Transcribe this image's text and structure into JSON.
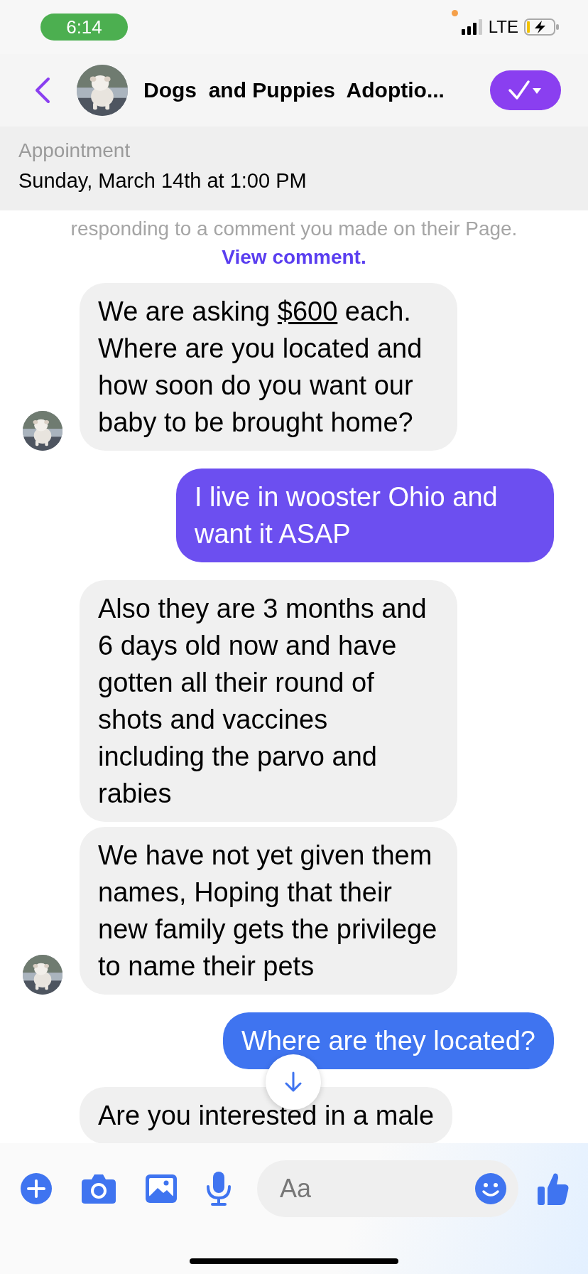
{
  "status_bar": {
    "time": "6:14",
    "network": "LTE"
  },
  "header": {
    "title": "Dogs  and Puppies  Adoptio..."
  },
  "appointment": {
    "label": "Appointment",
    "value": "Sunday, March 14th at 1:00 PM"
  },
  "notice": {
    "text": "responding to a comment you made on their Page.",
    "link": "View comment."
  },
  "messages": [
    {
      "kind": "incoming",
      "avatar": true,
      "parts": [
        {
          "text": "We are asking "
        },
        {
          "text": "$600",
          "underline": true
        },
        {
          "text": " each. Where are you located and how soon do you want our baby to be brought home?"
        }
      ]
    },
    {
      "kind": "outgoing",
      "color": "#6c4ff0",
      "parts": [
        {
          "text": "I live in wooster Ohio and want it ASAP"
        }
      ]
    },
    {
      "kind": "incoming",
      "avatar": false,
      "parts": [
        {
          "text": "Also they are 3 months and 6 days old now and have gotten all their round of shots and vaccines including the parvo and rabies"
        }
      ]
    },
    {
      "kind": "incoming",
      "avatar": true,
      "parts": [
        {
          "text": "We have not yet given them names, Hoping that their new family gets the privilege to name their pets"
        }
      ]
    },
    {
      "kind": "outgoing",
      "color": "#3f74f0",
      "parts": [
        {
          "text": "Where are they located?"
        }
      ]
    },
    {
      "kind": "incoming",
      "avatar": false,
      "parts": [
        {
          "text": "Are you interested in a male"
        }
      ]
    }
  ],
  "composer": {
    "placeholder": "Aa"
  }
}
